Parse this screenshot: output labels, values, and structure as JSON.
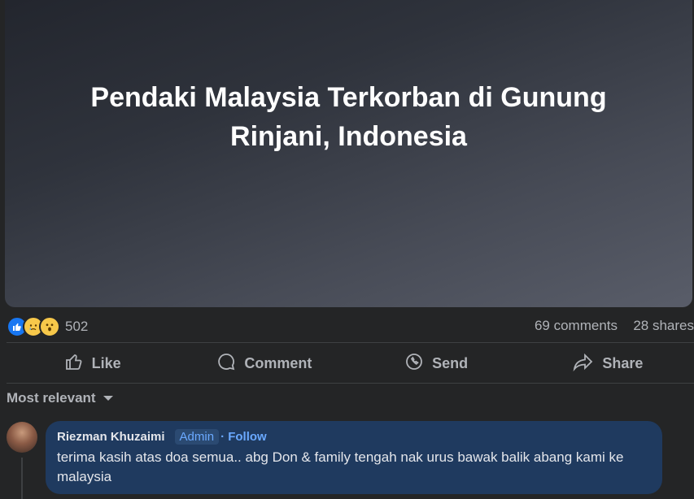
{
  "post": {
    "title": "Pendaki Malaysia Terkorban di Gunung Rinjani, Indonesia"
  },
  "stats": {
    "reaction_count": "502",
    "comments": "69 comments",
    "shares": "28 shares",
    "reaction_icons": [
      "like-icon",
      "sad-icon",
      "wow-icon"
    ]
  },
  "actions": {
    "like": "Like",
    "comment": "Comment",
    "send": "Send",
    "share": "Share"
  },
  "comments_section": {
    "sort_label": "Most relevant",
    "comment": {
      "author": "Riezman Khuzaimi",
      "badge": "Admin",
      "follow": "· Follow",
      "text": "terima kasih atas doa semua.. abg Don & family tengah nak urus bawak balik abang kami ke malaysia"
    }
  },
  "colors": {
    "background": "#242526",
    "accent_blue": "#1877f2",
    "comment_bubble": "#1f3a5f"
  }
}
